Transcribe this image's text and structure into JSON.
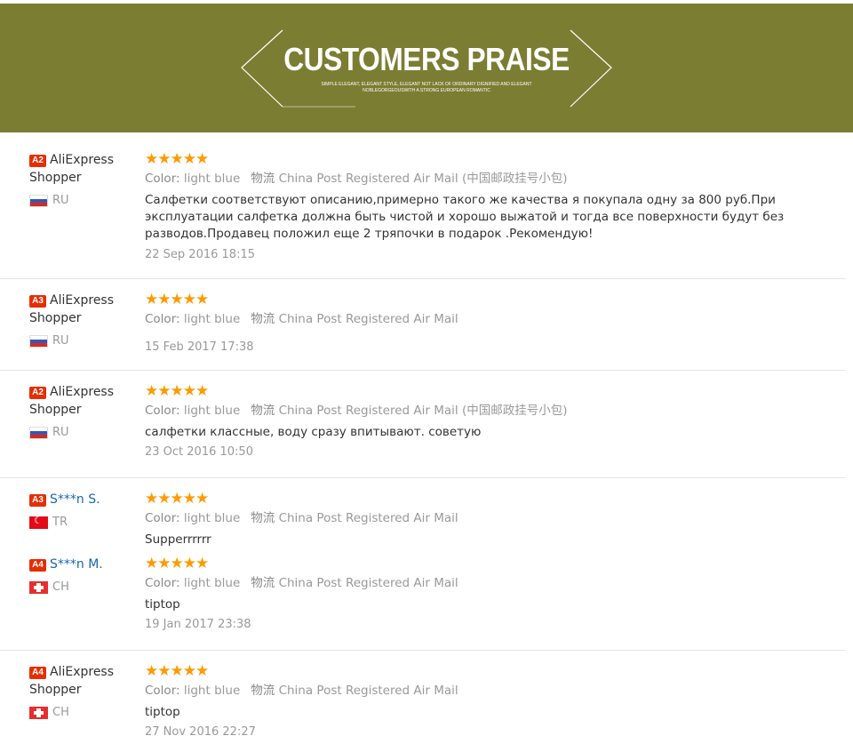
{
  "banner": {
    "title": "CUSTOMERS PRAISE",
    "subtitle_line1": "SIMPLE ELEGANT, ELEGANT STYLE, ELEGANT  NOT LACK OF ORDINARY DIGNIFIED AND ELEGANT",
    "subtitle_line2": "NOBLEGORGEOUSWITH A STRONG EUROPEAN ROMANTIC",
    "bg_color": "#7b7d33"
  },
  "labels": {
    "color": "Color:",
    "logistics": "物流",
    "stars": "★★★★★"
  },
  "reviews": [
    {
      "badge": "A2",
      "name": "AliExpress Shopper",
      "country": "RU",
      "flag": "ru",
      "color": "light blue",
      "shipping": "China Post Registered Air Mail (中国邮政挂号小包)",
      "text": "Салфетки соответствуют описанию,примерно такого же качества я покупала одну за 800 руб.При эксплуатации салфетка должна быть чистой и хорошо выжатой и тогда все поверхности будут без разводов.Продавец положил еще 2 тряпочки в подарок .Рекомендую!",
      "date": "22 Sep 2016 18:15",
      "rating": 5
    },
    {
      "badge": "A3",
      "name": "AliExpress Shopper",
      "country": "RU",
      "flag": "ru",
      "color": "light blue",
      "shipping": "China Post Registered Air Mail",
      "text": "",
      "date": "15 Feb 2017 17:38",
      "rating": 5
    },
    {
      "badge": "A2",
      "name": "AliExpress Shopper",
      "country": "RU",
      "flag": "ru",
      "color": "light blue",
      "shipping": "China Post Registered Air Mail (中国邮政挂号小包)",
      "text": "салфетки классные, воду сразу впитывают. советую",
      "date": "23 Oct 2016 10:50",
      "rating": 5
    },
    {
      "badge": "A3",
      "name": "S***n S.",
      "country": "TR",
      "flag": "tr",
      "color": "light blue",
      "shipping": "China Post Registered Air Mail",
      "text": "Supperrrrrr",
      "date": "",
      "rating": 5
    },
    {
      "badge": "A4",
      "name": "S***n M.",
      "country": "CH",
      "flag": "ch",
      "color": "light blue",
      "shipping": "China Post Registered Air Mail",
      "text": "tiptop",
      "date": "19 Jan 2017 23:38",
      "rating": 5
    },
    {
      "badge": "A4",
      "name": "AliExpress Shopper",
      "country": "CH",
      "flag": "ch",
      "color": "light blue",
      "shipping": "China Post Registered Air Mail",
      "text": "tiptop",
      "date": "27 Nov 2016 22:27",
      "rating": 5
    }
  ]
}
